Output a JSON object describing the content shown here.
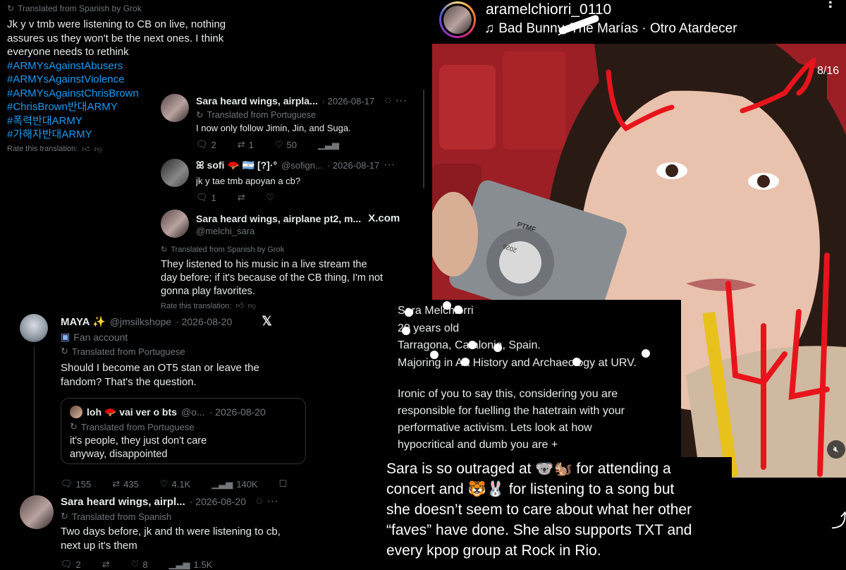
{
  "tweet_top": {
    "translated_label": "Translated from Spanish by Grok",
    "lines": [
      "Jk y v tmb were listening to CB on live, nothing",
      "assures us they won't be the next ones. I think",
      "everyone needs to rethink"
    ],
    "hashtags": [
      "#ARMYsAgainstAbusers",
      "#ARMYsAgainstViolence",
      "#ARMYsAgainstChrisBrown",
      "#ChrisBrown반대ARMY",
      "#폭력반대ARMY",
      "#가해자반대ARMY"
    ],
    "rate_label": "Rate this translation:"
  },
  "reply1": {
    "name": "Sara heard wings, airpla...",
    "date": "· 2026-08-17",
    "translated_label": "Translated from Portuguese",
    "text": "I now only follow Jimin, Jin, and Suga.",
    "stats": {
      "replies": "2",
      "retweets": "1",
      "likes": "50"
    }
  },
  "reply2": {
    "name": "ꕤ sofi 🪭 🇦🇷 [?]·°",
    "handle": "@sofign...",
    "date": "· 2026-08-17",
    "text": "jk y tae tmb apoyan a cb?",
    "stats": {
      "replies": "1"
    }
  },
  "reply3": {
    "name": "Sara heard wings, airplane pt2, m...",
    "handle": "@melchi_sara",
    "site": "X.com",
    "translated_label": "Translated from Spanish by Grok",
    "lines": [
      "They listened to his music in a live stream the",
      "day before; if it's because of the CB thing, I'm not",
      "gonna play favorites."
    ],
    "rate_label": "Rate this translation:"
  },
  "maya": {
    "name": "MAYA ✨",
    "handle": "@jmsilkshope",
    "date": "· 2026-08-20",
    "fan_label": "Fan account",
    "translated_label": "Translated from Portuguese",
    "lines": [
      "Should I become an OT5 stan or leave the",
      "fandom? That's the question."
    ],
    "quote": {
      "name": "loh 🪭 vai ver o bts",
      "handle": "@o...",
      "date": "· 2026-08-20",
      "translated_label": "Translated from Portuguese",
      "lines": [
        "it's people, they just don't care",
        "anyway, disappointed"
      ]
    },
    "stats": {
      "replies": "155",
      "retweets": "435",
      "likes": "4.1K",
      "views": "140K"
    }
  },
  "sara_bottom": {
    "name": "Sara heard wings, airpl...",
    "date": "· 2026-08-20",
    "translated_label": "Translated from Spanish",
    "lines": [
      "Two days before, jk and th were listening to cb,",
      "next up it's them"
    ],
    "stats": {
      "replies": "2",
      "likes": "8",
      "views": "1.5K"
    }
  },
  "story": {
    "username": "aramelchiorri_0110",
    "music": "Bad Bunny, The Marías · Otro Atardecer",
    "counter": "8/16",
    "camera_brand": "PTMF",
    "camera_year": "2026"
  },
  "bio": {
    "lines": [
      "Sara Melchiorri",
      "20 years old",
      "Tarragona, Catalonia, Spain.",
      "Majoring in Art History and Archaeology at URV."
    ],
    "paragraph": [
      "Ironic of you to say this, considering you are",
      "responsible for fuelling the hatetrain with your",
      "performative activism. Lets look at how",
      "hypocritical and dumb you are +"
    ]
  },
  "caption": {
    "lines": [
      "Sara is so outraged at 🐨🐿️ for attending a",
      "concert and 🐯🐰 for listening to a song but",
      "she doesn’t seem to care about what her other",
      "“faves” have done. She also supports TXT and",
      "every kpop group at Rock in Rio."
    ]
  },
  "colors": {
    "link": "#1d9bf0",
    "muted": "#71767b",
    "text": "#e7e9ea",
    "marker": "#e8141c"
  }
}
